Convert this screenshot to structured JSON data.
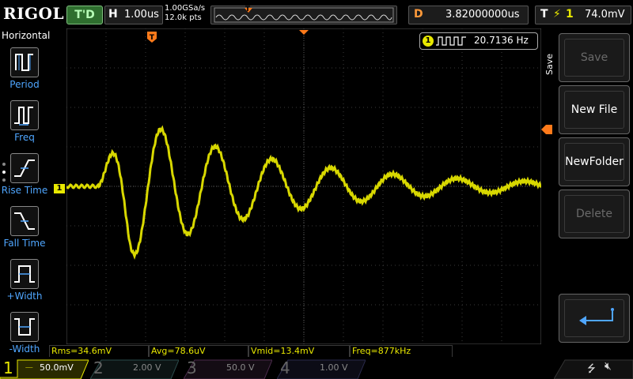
{
  "brand": "RIGOL",
  "trigger_status": "T'D",
  "horizontal": {
    "key": "H",
    "value": "1.00us"
  },
  "sampling": {
    "rate": "1.00GSa/s",
    "points": "12.0k pts"
  },
  "timeline_marker": "T",
  "delay": {
    "key": "D",
    "value": "3.82000000us"
  },
  "trigger": {
    "key": "T",
    "value": "74.0mV"
  },
  "left_menu": {
    "title": "Horizontal",
    "items": [
      {
        "label": "Period"
      },
      {
        "label": "Freq"
      },
      {
        "label": "Rise Time"
      },
      {
        "label": "Fall Time"
      },
      {
        "label": "+Width"
      },
      {
        "label": "-Width"
      }
    ]
  },
  "freq_counter": {
    "channel": "1",
    "value": "20.7136 Hz"
  },
  "ch1_marker": "1",
  "right_menu": {
    "side_label": "Save",
    "buttons": [
      {
        "label": "Save",
        "enabled": false
      },
      {
        "label": "New File",
        "enabled": true
      },
      {
        "label": "NewFolder",
        "enabled": true
      },
      {
        "label": "Delete",
        "enabled": false
      }
    ]
  },
  "measurements": [
    {
      "text": "Rms=34.6mV"
    },
    {
      "text": "Avg=78.6uV"
    },
    {
      "text": "Vmid=13.4mV"
    },
    {
      "text": "Freq=877kHz"
    }
  ],
  "channels": [
    {
      "num": "1",
      "value": "50.0mV",
      "color": "#e8e800"
    },
    {
      "num": "2",
      "value": "2.00 V",
      "color": "#00c8c8"
    },
    {
      "num": "3",
      "value": "50.0 V",
      "color": "#e040e0"
    },
    {
      "num": "4",
      "value": "1.00 V",
      "color": "#2f6fff"
    }
  ],
  "colors": {
    "trace": "#f0f000",
    "accent": "#4fa6ff",
    "trigger_marker": "#ff7a1a"
  }
}
